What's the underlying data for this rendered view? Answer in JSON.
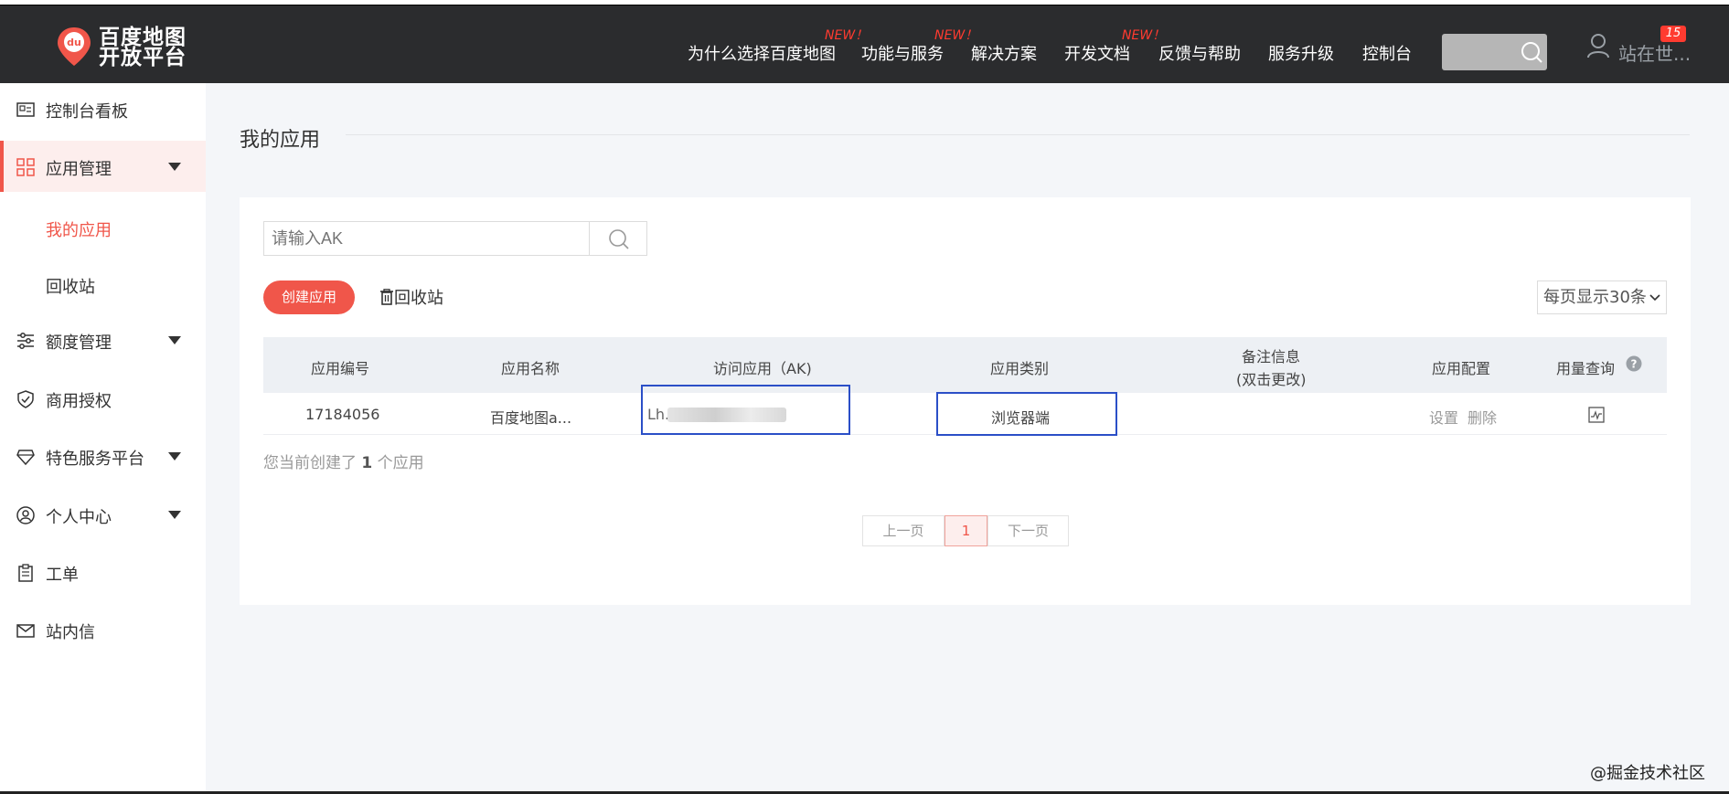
{
  "header": {
    "logo_line1": "百度地图",
    "logo_line2": "开放平台",
    "nav": [
      {
        "label": "为什么选择百度地图",
        "new": ""
      },
      {
        "label": "功能与服务",
        "new": "NEW！"
      },
      {
        "label": "解决方案",
        "new": "NEW！"
      },
      {
        "label": "开发文档",
        "new": ""
      },
      {
        "label": "反馈与帮助",
        "new": "NEW！"
      },
      {
        "label": "服务升级",
        "new": ""
      },
      {
        "label": "控制台",
        "new": ""
      }
    ],
    "new_tag": "NEW！",
    "user_name": "站在世...",
    "badge_count": "15"
  },
  "sidebar": {
    "items": [
      {
        "label": "控制台看板"
      },
      {
        "label": "应用管理"
      },
      {
        "label": "额度管理"
      },
      {
        "label": "商用授权"
      },
      {
        "label": "特色服务平台"
      },
      {
        "label": "个人中心"
      },
      {
        "label": "工单"
      },
      {
        "label": "站内信"
      }
    ],
    "sub_items": [
      {
        "label": "我的应用"
      },
      {
        "label": "回收站"
      }
    ]
  },
  "main": {
    "title": "我的应用",
    "search_placeholder": "请输入AK",
    "create_label": "创建应用",
    "recycle_label": "回收站",
    "page_size_label": "每页显示30条",
    "table": {
      "headers": [
        "应用编号",
        "应用名称",
        "访问应用（AK)",
        "应用类别",
        "备注信息",
        "(双击更改)",
        "应用配置",
        "用量查询"
      ],
      "row": {
        "id": "17184056",
        "name": "百度地图a...",
        "ak": "Lh...",
        "category": "浏览器端",
        "remark": "",
        "config_set": "设置",
        "config_delete": "删除"
      }
    },
    "summary_prefix": "您当前创建了",
    "summary_count": "1",
    "summary_suffix": "个应用",
    "pager": {
      "prev": "上一页",
      "current": "1",
      "next": "下一页"
    }
  },
  "watermark": "@掘金技术社区",
  "colors": {
    "brand_red": "#f0564a",
    "topbar": "#2b2c2e",
    "highlight_box": "#2b4fc7"
  }
}
